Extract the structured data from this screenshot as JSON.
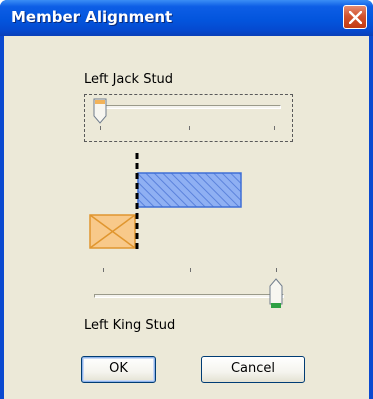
{
  "window": {
    "title": "Member Alignment",
    "close_icon": "close-icon"
  },
  "jack_slider": {
    "label": "Left Jack Stud",
    "value_fraction": 0.0,
    "tick_count": 3
  },
  "king_slider": {
    "label": "Left King Stud",
    "value_fraction": 1.0,
    "tick_count": 3
  },
  "buttons": {
    "ok_label": "OK",
    "cancel_label": "Cancel"
  },
  "colors": {
    "titlebar": "#0355dd",
    "dialog_background": "#ece9d8",
    "jack_member_fill": "#7aa2f2",
    "king_member_fill": "#f8c98a",
    "alignment_line": "#000000",
    "king_thumb_accent": "#2ea043"
  }
}
